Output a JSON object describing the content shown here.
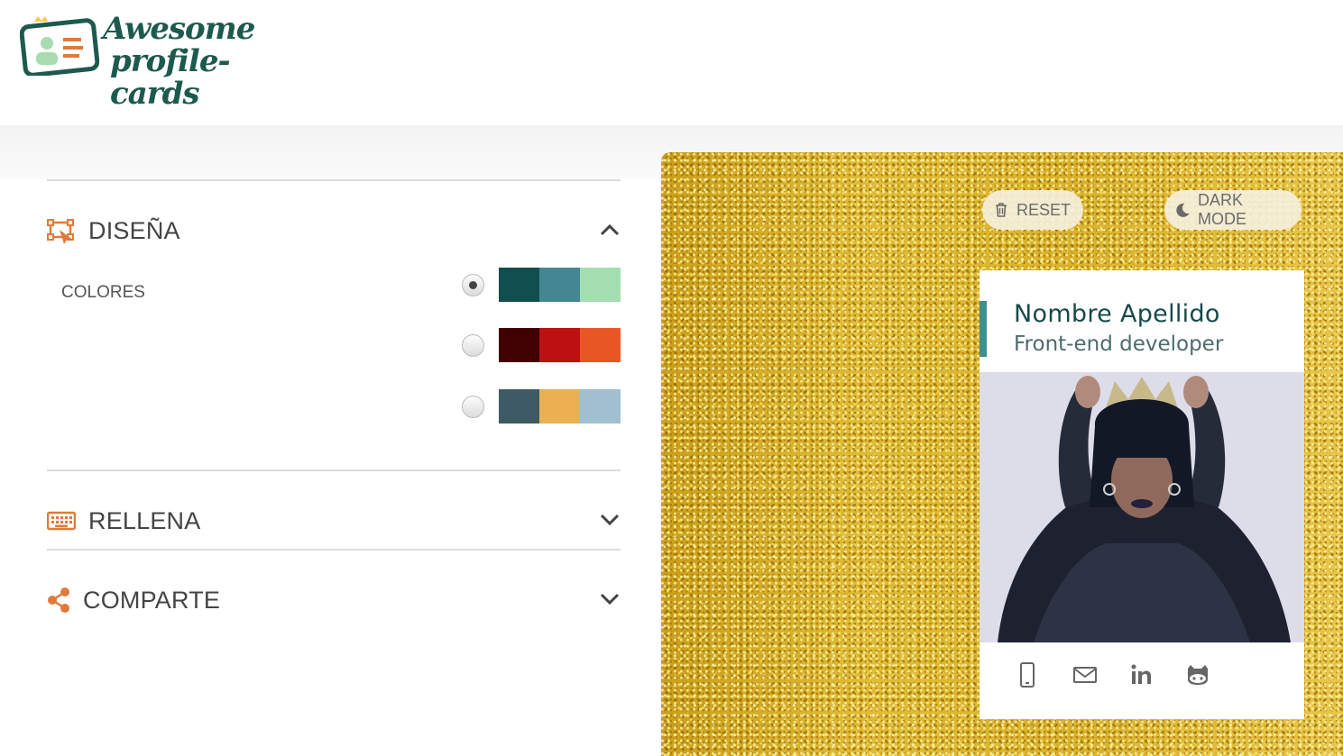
{
  "header": {
    "logo_line1": "Awesome",
    "logo_line2": "profile-cards"
  },
  "sections": {
    "design": {
      "title": "DISEÑA",
      "icon": "design-icon",
      "expanded": true
    },
    "colors_label": "COLORES",
    "palettes": [
      {
        "selected": true,
        "colors": [
          "#114e4e",
          "#438792",
          "#a2deaf"
        ]
      },
      {
        "selected": false,
        "colors": [
          "#420101",
          "#bd1010",
          "#e95626"
        ]
      },
      {
        "selected": false,
        "colors": [
          "#3e5b65",
          "#eab052",
          "#a0c0cf"
        ]
      }
    ],
    "fill": {
      "title": "RELLENA",
      "icon": "keyboard-icon",
      "expanded": false
    },
    "share": {
      "title": "COMPARTE",
      "icon": "share-icon",
      "expanded": false
    }
  },
  "preview": {
    "reset_label": "RESET",
    "dark_mode_label": "DARK MODE",
    "card": {
      "name": "Nombre Apellido",
      "job": "Front-end developer",
      "accent_color": "#3f8e91",
      "social_icons": [
        "phone-icon",
        "email-icon",
        "linkedin-icon",
        "github-icon"
      ]
    }
  },
  "colors": {
    "accent_orange": "#e07a3b",
    "logo_green": "#1d5a4e"
  }
}
